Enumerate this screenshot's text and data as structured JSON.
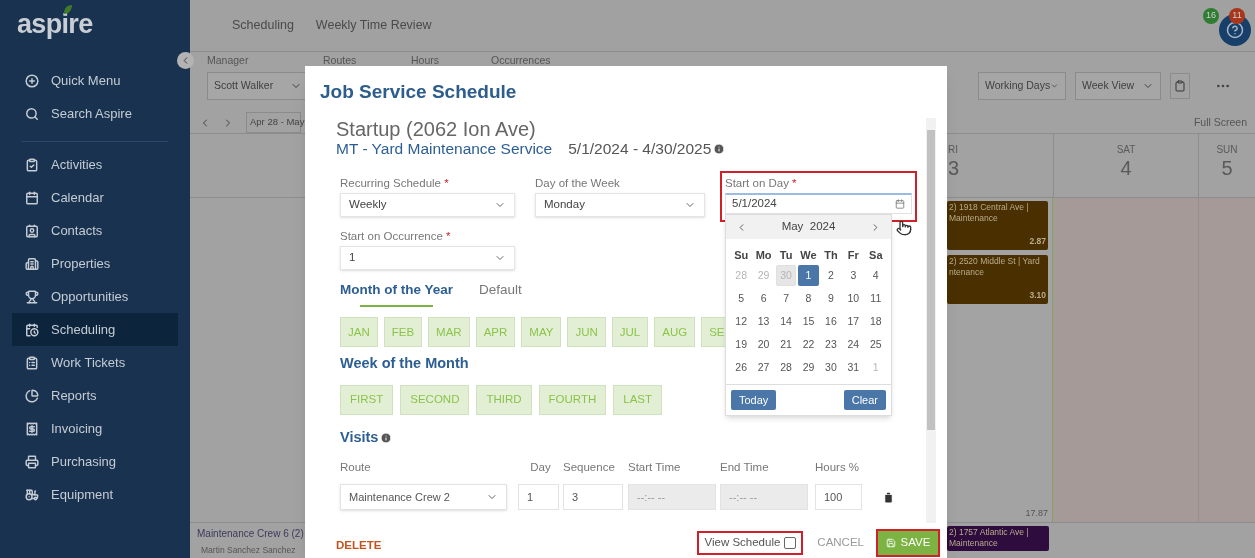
{
  "sidebar": {
    "logo": "aspire",
    "top_items": [
      "Quick Menu",
      "Search Aspire"
    ],
    "items": [
      {
        "label": "Activities",
        "selected": false
      },
      {
        "label": "Calendar",
        "selected": false
      },
      {
        "label": "Contacts",
        "selected": false
      },
      {
        "label": "Properties",
        "selected": false
      },
      {
        "label": "Opportunities",
        "selected": false
      },
      {
        "label": "Scheduling",
        "selected": true
      },
      {
        "label": "Work Tickets",
        "selected": false
      },
      {
        "label": "Reports",
        "selected": false
      },
      {
        "label": "Invoicing",
        "selected": false
      },
      {
        "label": "Purchasing",
        "selected": false
      },
      {
        "label": "Equipment",
        "selected": false
      }
    ]
  },
  "top_tabs": [
    "Scheduling",
    "Weekly Time Review"
  ],
  "help": {
    "badges": [
      {
        "count": "16",
        "color": "#2f7d32"
      },
      {
        "count": "11",
        "color": "#a8361a"
      }
    ]
  },
  "filters": {
    "manager_label": "Manager",
    "manager": "Scott Walker",
    "labels": [
      "Routes",
      "Hours",
      "Occurrences"
    ],
    "working_days": "Working Days",
    "view": "Week View"
  },
  "toolbar": {
    "range": "Apr 28 - May",
    "full_screen": "Full Screen"
  },
  "calendar": {
    "days": [
      {
        "name": "RI",
        "number": "3",
        "weekend": false
      },
      {
        "name": "SAT",
        "number": "4",
        "weekend": true
      },
      {
        "name": "SUN",
        "number": "5",
        "weekend": true
      }
    ],
    "events": [
      {
        "lines": [
          "2) 1918 Central Ave |",
          "Maintenance"
        ],
        "hours": "2.87",
        "color": "#4a3000"
      },
      {
        "lines": [
          "2) 2520 Middle St | Yard",
          "ntenance"
        ],
        "hours": "3.10",
        "color": "#4a3000"
      }
    ],
    "total": "17.87",
    "crew": {
      "name": "Maintenance Crew 6 (2)",
      "member": "Martin Sanchez Sanchez"
    },
    "crew_events": [
      {
        "lines": [
          "2) 1757 Atlantic Ave |",
          "Maintenance"
        ],
        "color": "#2e0d3e"
      }
    ]
  },
  "modal": {
    "title": "Job Service Schedule",
    "property": "Startup (2062 Ion Ave)",
    "service": "MT - Yard Maintenance Service",
    "dates": "5/1/2024 - 4/30/2025",
    "fields": [
      {
        "label": "Recurring Schedule",
        "required_mark": "*",
        "value": "Weekly",
        "kind": "select"
      },
      {
        "label": "Day of the Week",
        "value": "Monday",
        "kind": "select"
      },
      {
        "label": "Start on Day",
        "required_mark": "*",
        "value": "5/1/2024",
        "kind": "date",
        "highlighted": true
      },
      {
        "label": "Start on Occurrence",
        "required_mark": "*",
        "value": "1",
        "kind": "select"
      }
    ],
    "section_tabs": [
      {
        "label": "Month of the Year",
        "selected": true
      },
      {
        "label": "Default",
        "selected": false
      }
    ],
    "months": [
      "JAN",
      "FEB",
      "MAR",
      "APR",
      "MAY",
      "JUN",
      "JUL",
      "AUG",
      "SE"
    ],
    "week_heading": "Week of the Month",
    "weeks": [
      "FIRST",
      "SECOND",
      "THIRD",
      "FOURTH",
      "LAST"
    ],
    "visits": {
      "heading": "Visits",
      "columns": [
        "Route",
        "Day",
        "Sequence",
        "Start Time",
        "End Time",
        "Hours %"
      ],
      "row": {
        "route": "Maintenance Crew 2",
        "day": "1",
        "sequence": "3",
        "start_time": {
          "placeholder": "--:-- --"
        },
        "end_time": {
          "placeholder": "--:-- --"
        },
        "hours": "100"
      }
    },
    "footer": {
      "delete": "DELETE",
      "view_schedule": {
        "label": "View Schedule",
        "checked": false,
        "highlighted": true
      },
      "cancel": "CANCEL",
      "save": {
        "label": "SAVE",
        "highlighted": true
      }
    },
    "datepicker": {
      "month": "May  2024",
      "weekdays": [
        "Su",
        "Mo",
        "Tu",
        "We",
        "Th",
        "Fr",
        "Sa"
      ],
      "weeks": [
        [
          {
            "label": "28",
            "other_month": true,
            "selected": false,
            "today": false
          },
          {
            "label": "29",
            "other_month": true,
            "selected": false,
            "today": false
          },
          {
            "label": "30",
            "other_month": true,
            "selected": false,
            "today": true
          },
          {
            "label": "1",
            "other_month": false,
            "selected": true,
            "today": false
          },
          {
            "label": "2",
            "other_month": false,
            "selected": false,
            "today": false
          },
          {
            "label": "3",
            "other_month": false,
            "selected": false,
            "today": false
          },
          {
            "label": "4",
            "other_month": false,
            "selected": false,
            "today": false
          }
        ],
        [
          {
            "label": "5",
            "other_month": false,
            "selected": false,
            "today": false
          },
          {
            "label": "6",
            "other_month": false,
            "selected": false,
            "today": false
          },
          {
            "label": "7",
            "other_month": false,
            "selected": false,
            "today": false
          },
          {
            "label": "8",
            "other_month": false,
            "selected": false,
            "today": false
          },
          {
            "label": "9",
            "other_month": false,
            "selected": false,
            "today": false
          },
          {
            "label": "10",
            "other_month": false,
            "selected": false,
            "today": false
          },
          {
            "label": "11",
            "other_month": false,
            "selected": false,
            "today": false
          }
        ],
        [
          {
            "label": "12",
            "other_month": false,
            "selected": false,
            "today": false
          },
          {
            "label": "13",
            "other_month": false,
            "selected": false,
            "today": false
          },
          {
            "label": "14",
            "other_month": false,
            "selected": false,
            "today": false
          },
          {
            "label": "15",
            "other_month": false,
            "selected": false,
            "today": false
          },
          {
            "label": "16",
            "other_month": false,
            "selected": false,
            "today": false
          },
          {
            "label": "17",
            "other_month": false,
            "selected": false,
            "today": false
          },
          {
            "label": "18",
            "other_month": false,
            "selected": false,
            "today": false
          }
        ],
        [
          {
            "label": "19",
            "other_month": false,
            "selected": false,
            "today": false
          },
          {
            "label": "20",
            "other_month": false,
            "selected": false,
            "today": false
          },
          {
            "label": "21",
            "other_month": false,
            "selected": false,
            "today": false
          },
          {
            "label": "22",
            "other_month": false,
            "selected": false,
            "today": false
          },
          {
            "label": "23",
            "other_month": false,
            "selected": false,
            "today": false
          },
          {
            "label": "24",
            "other_month": false,
            "selected": false,
            "today": false
          },
          {
            "label": "25",
            "other_month": false,
            "selected": false,
            "today": false
          }
        ],
        [
          {
            "label": "26",
            "other_month": false,
            "selected": false,
            "today": false
          },
          {
            "label": "27",
            "other_month": false,
            "selected": false,
            "today": false
          },
          {
            "label": "28",
            "other_month": false,
            "selected": false,
            "today": false
          },
          {
            "label": "29",
            "other_month": false,
            "selected": false,
            "today": false
          },
          {
            "label": "30",
            "other_month": false,
            "selected": false,
            "today": false
          },
          {
            "label": "31",
            "other_month": false,
            "selected": false,
            "today": false
          },
          {
            "label": "1",
            "other_month": true,
            "selected": false,
            "today": false
          }
        ]
      ],
      "today_button": "Today",
      "clear_button": "Clear"
    }
  }
}
